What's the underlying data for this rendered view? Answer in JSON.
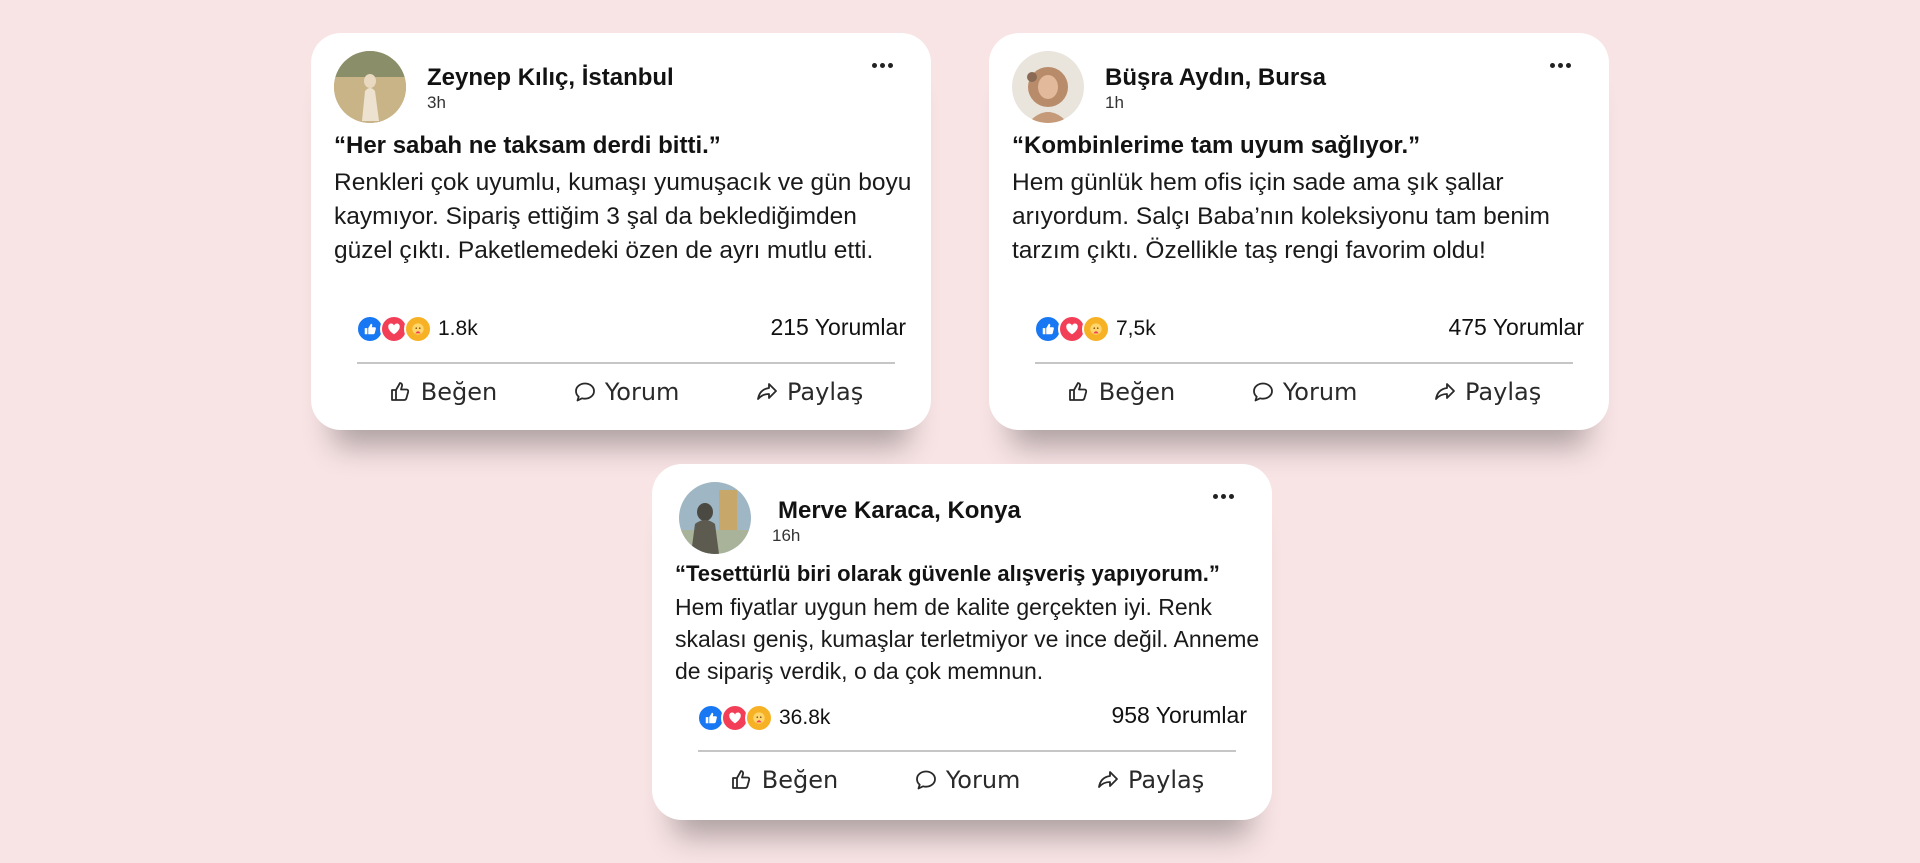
{
  "posts": [
    {
      "author": "Zeynep Kılıç, İstanbul",
      "time": "3h",
      "quote": "“Her sabah ne taksam derdi bitti.”",
      "body": "Renkleri çok uyumlu, kumaşı yumuşacık ve gün boyu kaymıyor. Sipariş ettiğim 3 şal da beklediğimden güzel çıktı. Paketlemedeki özen de ayrı mutlu etti.",
      "reactions_count": "1.8k",
      "comments": "215 Yorumlar"
    },
    {
      "author": "Büşra Aydın, Bursa",
      "time": "1h",
      "quote": "“Kombinlerime tam uyum sağlıyor.”",
      "body": "Hem günlük hem ofis için sade ama şık şallar arıyordum. Salçı Baba’nın koleksiyonu tam benim tarzım çıktı. Özellikle taş rengi favorim oldu!",
      "reactions_count": "7,5k",
      "comments": "475 Yorumlar"
    },
    {
      "author": "Merve Karaca, Konya",
      "time": "16h",
      "quote": "“Tesettürlü biri olarak güvenle alışveriş yapıyorum.”",
      "body": "Hem fiyatlar uygun hem de kalite gerçekten iyi. Renk skalası geniş, kumaşlar terletmiyor ve ince değil. Anneme de sipariş verdik, o da çok memnun.",
      "reactions_count": "36.8k",
      "comments": "958 Yorumlar"
    }
  ],
  "actions": {
    "like": "Beğen",
    "comment": "Yorum",
    "share": "Paylaş"
  },
  "icons": {
    "like": "thumbs-up-icon",
    "comment": "speech-bubble-icon",
    "share": "share-arrow-icon",
    "more": "more-dots-icon",
    "reactions": [
      "like-reaction-icon",
      "love-reaction-icon",
      "care-reaction-icon"
    ]
  },
  "colors": {
    "background": "#f8e4e5",
    "card": "#ffffff",
    "like_reaction": "#1877f2",
    "love_reaction": "#f33e58",
    "care_reaction": "#f7b125"
  }
}
